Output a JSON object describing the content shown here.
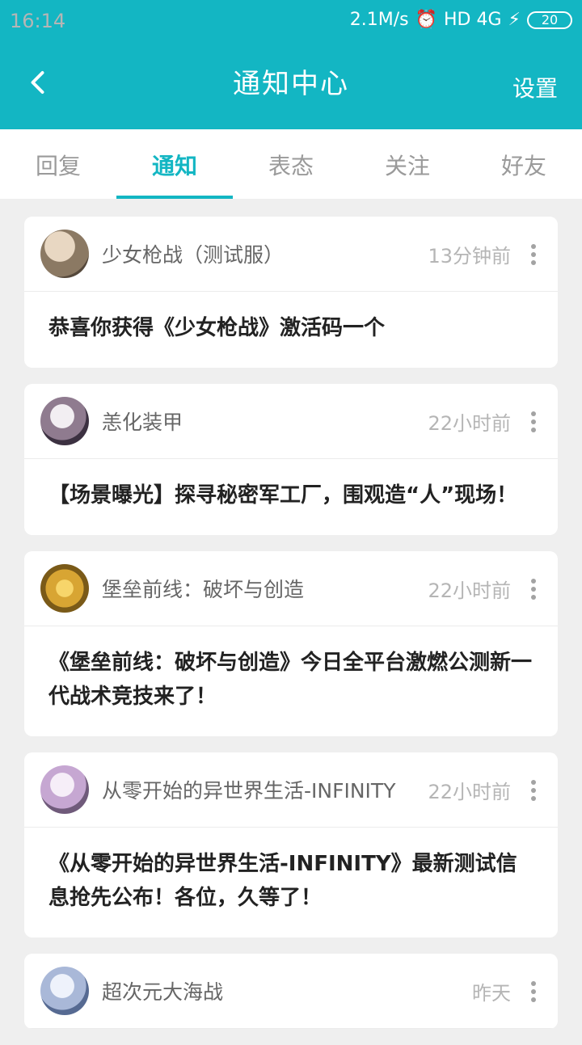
{
  "status_bar": {
    "time": "16:14",
    "speed": "2.1M/s",
    "network": "HD 4G",
    "battery": "20",
    "icons": [
      "alarm-icon",
      "signal-icon",
      "charging-icon",
      "battery-icon"
    ]
  },
  "header": {
    "back_icon": "back-arrow-icon",
    "title": "通知中心",
    "settings_label": "设置"
  },
  "tabs": [
    {
      "label": "回复",
      "active": false
    },
    {
      "label": "通知",
      "active": true
    },
    {
      "label": "表态",
      "active": false
    },
    {
      "label": "关注",
      "active": false
    },
    {
      "label": "好友",
      "active": false
    }
  ],
  "notifications": [
    {
      "source": "少女枪战（测试服）",
      "time": "13分钟前",
      "content": "恭喜你获得《少女枪战》激活码一个",
      "avatar_color": "#bba58a"
    },
    {
      "source": "恙化装甲",
      "time": "22小时前",
      "content": "【场景曝光】探寻秘密军工厂，围观造“人”现场！",
      "avatar_color": "#6a5a72"
    },
    {
      "source": "堡垒前线：破坏与创造",
      "time": "22小时前",
      "content": "《堡垒前线：破坏与创造》今日全平台激燃公测新一代战术竞技来了！",
      "avatar_color": "#d8a533"
    },
    {
      "source": "从零开始的异世界生活-INFINITY",
      "time": "22小时前",
      "content": "《从零开始的异世界生活-INFINITY》最新测试信息抢先公布！各位，久等了！",
      "avatar_color": "#c6a7d2"
    },
    {
      "source": "超次元大海战",
      "time": "昨天",
      "content": "",
      "avatar_color": "#a9b8d8"
    }
  ],
  "colors": {
    "accent": "#13b6c3",
    "background": "#efefef"
  }
}
